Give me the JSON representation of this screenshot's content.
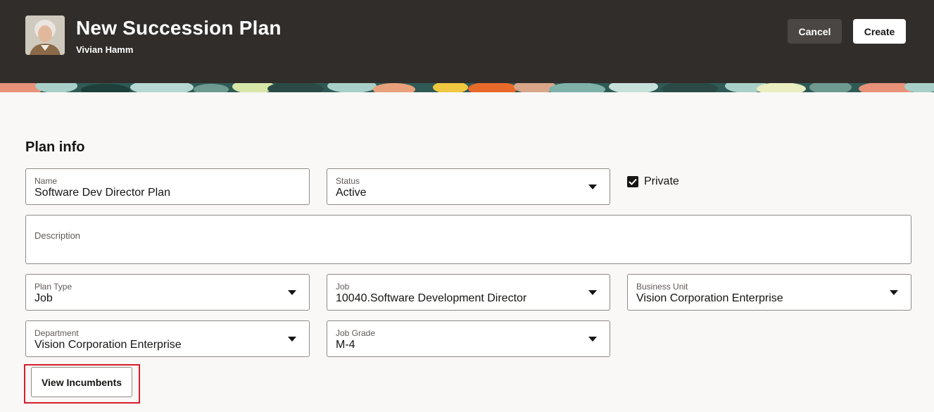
{
  "header": {
    "title": "New Succession Plan",
    "person_name": "Vivian Hamm",
    "cancel_label": "Cancel",
    "create_label": "Create"
  },
  "section": {
    "title": "Plan info"
  },
  "fields": {
    "name": {
      "label": "Name",
      "value": "Software Dev Director Plan"
    },
    "status": {
      "label": "Status",
      "value": "Active"
    },
    "private": {
      "label": "Private",
      "checked": true
    },
    "description": {
      "label": "Description",
      "value": ""
    },
    "plan_type": {
      "label": "Plan Type",
      "value": "Job"
    },
    "job": {
      "label": "Job",
      "value": "10040.Software Development Director"
    },
    "business_unit": {
      "label": "Business Unit",
      "value": "Vision Corporation Enterprise"
    },
    "department": {
      "label": "Department",
      "value": "Vision Corporation Enterprise"
    },
    "job_grade": {
      "label": "Job Grade",
      "value": "M-4"
    }
  },
  "actions": {
    "view_incumbents_label": "View Incumbents"
  },
  "colors": {
    "header_bg": "#312d2a",
    "page_bg": "#f9f8f6",
    "highlight": "#d41f2b"
  }
}
